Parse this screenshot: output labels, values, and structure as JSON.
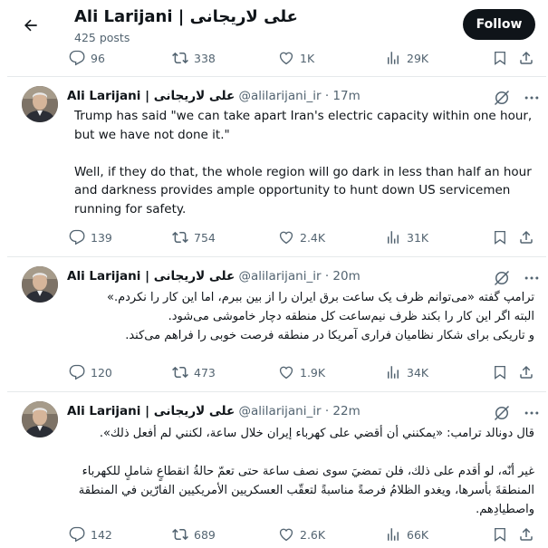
{
  "header": {
    "title": "Ali Larijani | علی لاریجانی",
    "posts": "425 posts",
    "follow_label": "Follow"
  },
  "top_actions": {
    "replies": "96",
    "reposts": "338",
    "likes": "1K",
    "views": "29K"
  },
  "tweets": [
    {
      "name": "Ali Larijani | علی لاریجانی",
      "handle": "@alilarijani_ir",
      "sep": "·",
      "time": "17m",
      "body": [
        "Trump has said \"we can take apart Iran's electric capacity within one hour, but we have not done it.\"",
        "",
        "Well, if they do that, the whole region will go dark in less than half an hour and darkness provides ample opportunity to hunt down US servicemen running for safety."
      ],
      "replies": "139",
      "reposts": "754",
      "likes": "2.4K",
      "views": "31K"
    },
    {
      "name": "Ali Larijani | علی لاریجانی",
      "handle": "@alilarijani_ir",
      "sep": "·",
      "time": "20m",
      "body": [
        "ترامپ گفته «می‌توانم ظرف یک ساعت برق ایران  را از بین ببرم، اما این کار را نکردم.»",
        "البته اگر این کار را بکند ظرف نیم‌ساعت کل منطقه دچار خاموشی می‌شود.",
        "و تاریکی برای شکار نظامیان فراری آمریکا در منطقه فرصت خوبی را فراهم می‌کند."
      ],
      "replies": "120",
      "reposts": "473",
      "likes": "1.9K",
      "views": "34K"
    },
    {
      "name": "Ali Larijani | علی لاریجانی",
      "handle": "@alilarijani_ir",
      "sep": "·",
      "time": "22m",
      "body": [
        "قال دونالد ترامب: «يمكنني أن أقضي على كهرباء إيران خلال ساعة، لكنني لم أفعل ذلك».",
        "",
        "غير أنّه، لو أقدم على ذلك، فلن تمضيَ سوى نصف ساعة حتى تعمّ حالةُ انقطاعٍ شاملٍ للكهرباء المنطقةَ بأسرها، ويغدو الظلامُ فرصةً مناسبةً لتعقّب العسكريين الأمريكيين الفارّين في المنطقة واصطيادِهم."
      ],
      "replies": "142",
      "reposts": "689",
      "likes": "2.6K",
      "views": "66K"
    }
  ]
}
